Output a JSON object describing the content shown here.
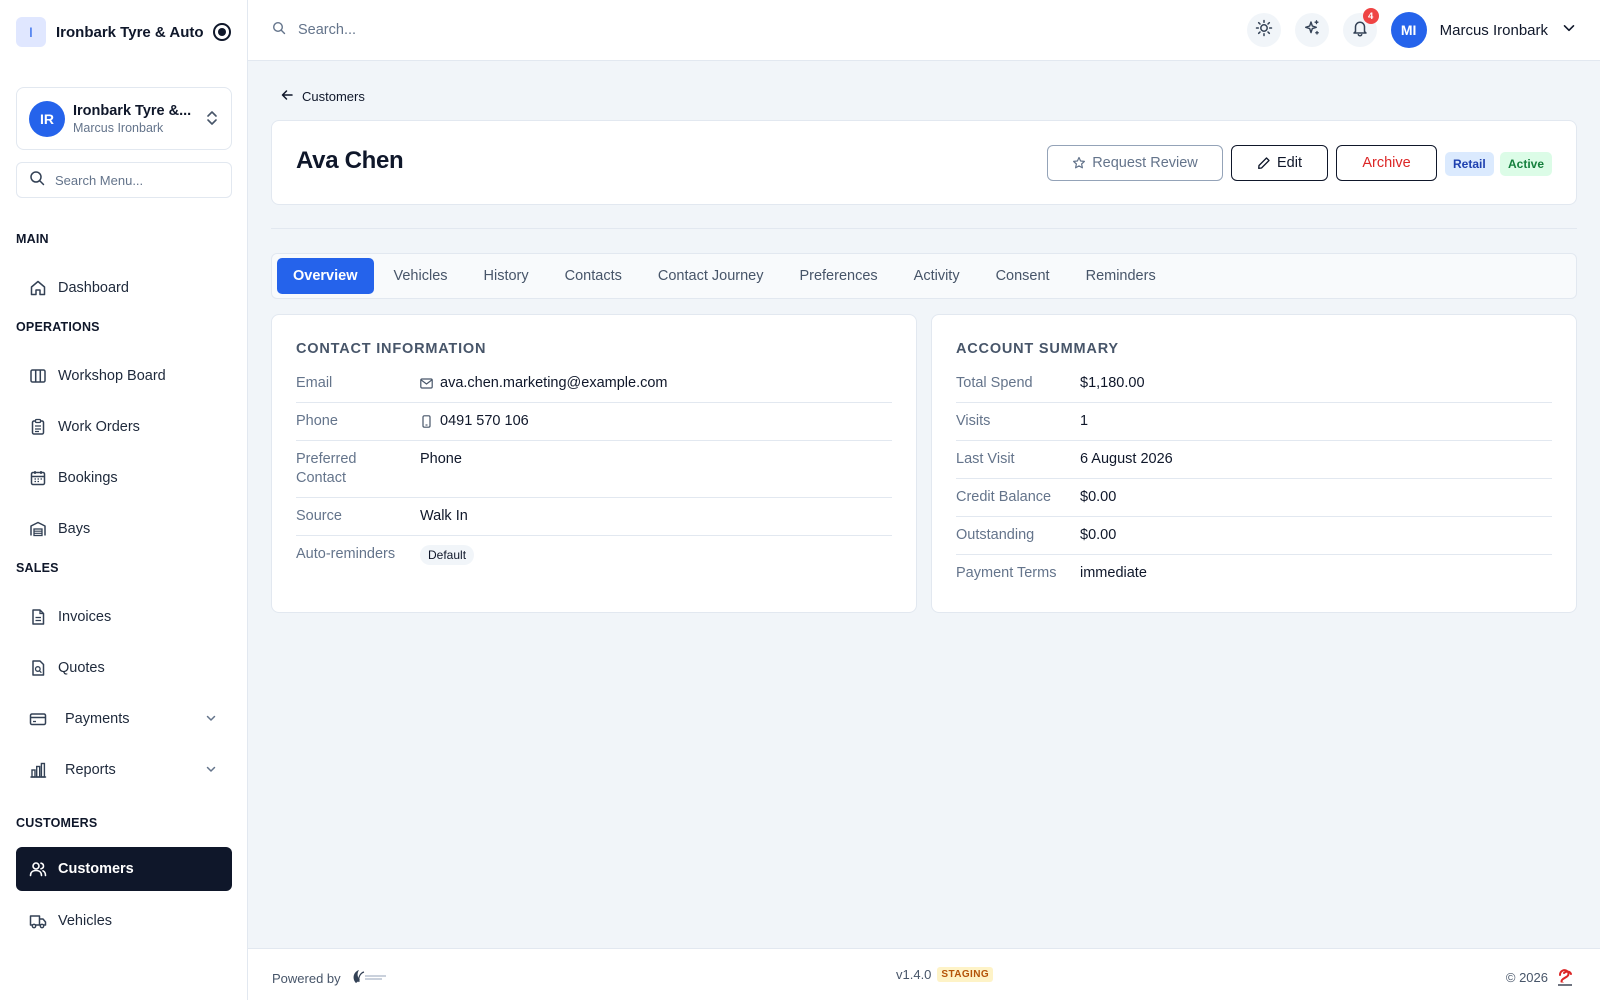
{
  "app": {
    "logo_letter": "I",
    "name": "Ironbark Tyre & Auto"
  },
  "org_switcher": {
    "avatar_initials": "IR",
    "org_name": "Ironbark Tyre &...",
    "user_name": "Marcus Ironbark"
  },
  "menu_search": {
    "placeholder": "Search Menu..."
  },
  "nav": {
    "sections": {
      "main": "MAIN",
      "operations": "OPERATIONS",
      "sales": "SALES",
      "customers": "CUSTOMERS"
    },
    "items": {
      "dashboard": "Dashboard",
      "workshop_board": "Workshop Board",
      "work_orders": "Work Orders",
      "bookings": "Bookings",
      "bays": "Bays",
      "invoices": "Invoices",
      "quotes": "Quotes",
      "payments": "Payments",
      "reports": "Reports",
      "customers": "Customers",
      "vehicles": "Vehicles"
    },
    "active": "customers"
  },
  "topbar": {
    "search_placeholder": "Search...",
    "notifications_count": "4",
    "user_initials": "MI",
    "user_name": "Marcus Ironbark"
  },
  "breadcrumb": {
    "back_label": "Customers"
  },
  "customer": {
    "name": "Ava Chen",
    "actions": {
      "request_review": "Request Review",
      "edit": "Edit",
      "archive": "Archive"
    },
    "badges": {
      "type": "Retail",
      "status": "Active"
    }
  },
  "tabs": [
    "Overview",
    "Vehicles",
    "History",
    "Contacts",
    "Contact Journey",
    "Preferences",
    "Activity",
    "Consent",
    "Reminders"
  ],
  "active_tab": "Overview",
  "contact_info": {
    "title": "CONTACT INFORMATION",
    "rows": [
      {
        "label": "Email",
        "value": "ava.chen.marketing@example.com",
        "icon": "mail-icon"
      },
      {
        "label": "Phone",
        "value": "0491 570 106",
        "icon": "phone-icon"
      },
      {
        "label": "Preferred Contact",
        "value": "Phone"
      },
      {
        "label": "Source",
        "value": "Walk In"
      },
      {
        "label": "Auto-reminders",
        "value": "Default"
      }
    ]
  },
  "account_summary": {
    "title": "ACCOUNT SUMMARY",
    "rows": [
      {
        "label": "Total Spend",
        "value": "$1,180.00"
      },
      {
        "label": "Visits",
        "value": "1"
      },
      {
        "label": "Last Visit",
        "value": "6 August 2026"
      },
      {
        "label": "Credit Balance",
        "value": "$0.00"
      },
      {
        "label": "Outstanding",
        "value": "$0.00"
      },
      {
        "label": "Payment Terms",
        "value": "immediate"
      }
    ]
  },
  "footer": {
    "powered_by": "Powered by",
    "version": "v1.4.0",
    "environment": "STAGING",
    "copyright": "© 2026"
  },
  "colors": {
    "primary": "#2563eb",
    "sidebar_active": "#0f172a",
    "archive_text": "#dc2626",
    "notification": "#ef4444",
    "retail_badge_bg": "#dbeafe",
    "active_badge_bg": "#dcfce7",
    "staging_badge_bg": "#fef3c7"
  }
}
